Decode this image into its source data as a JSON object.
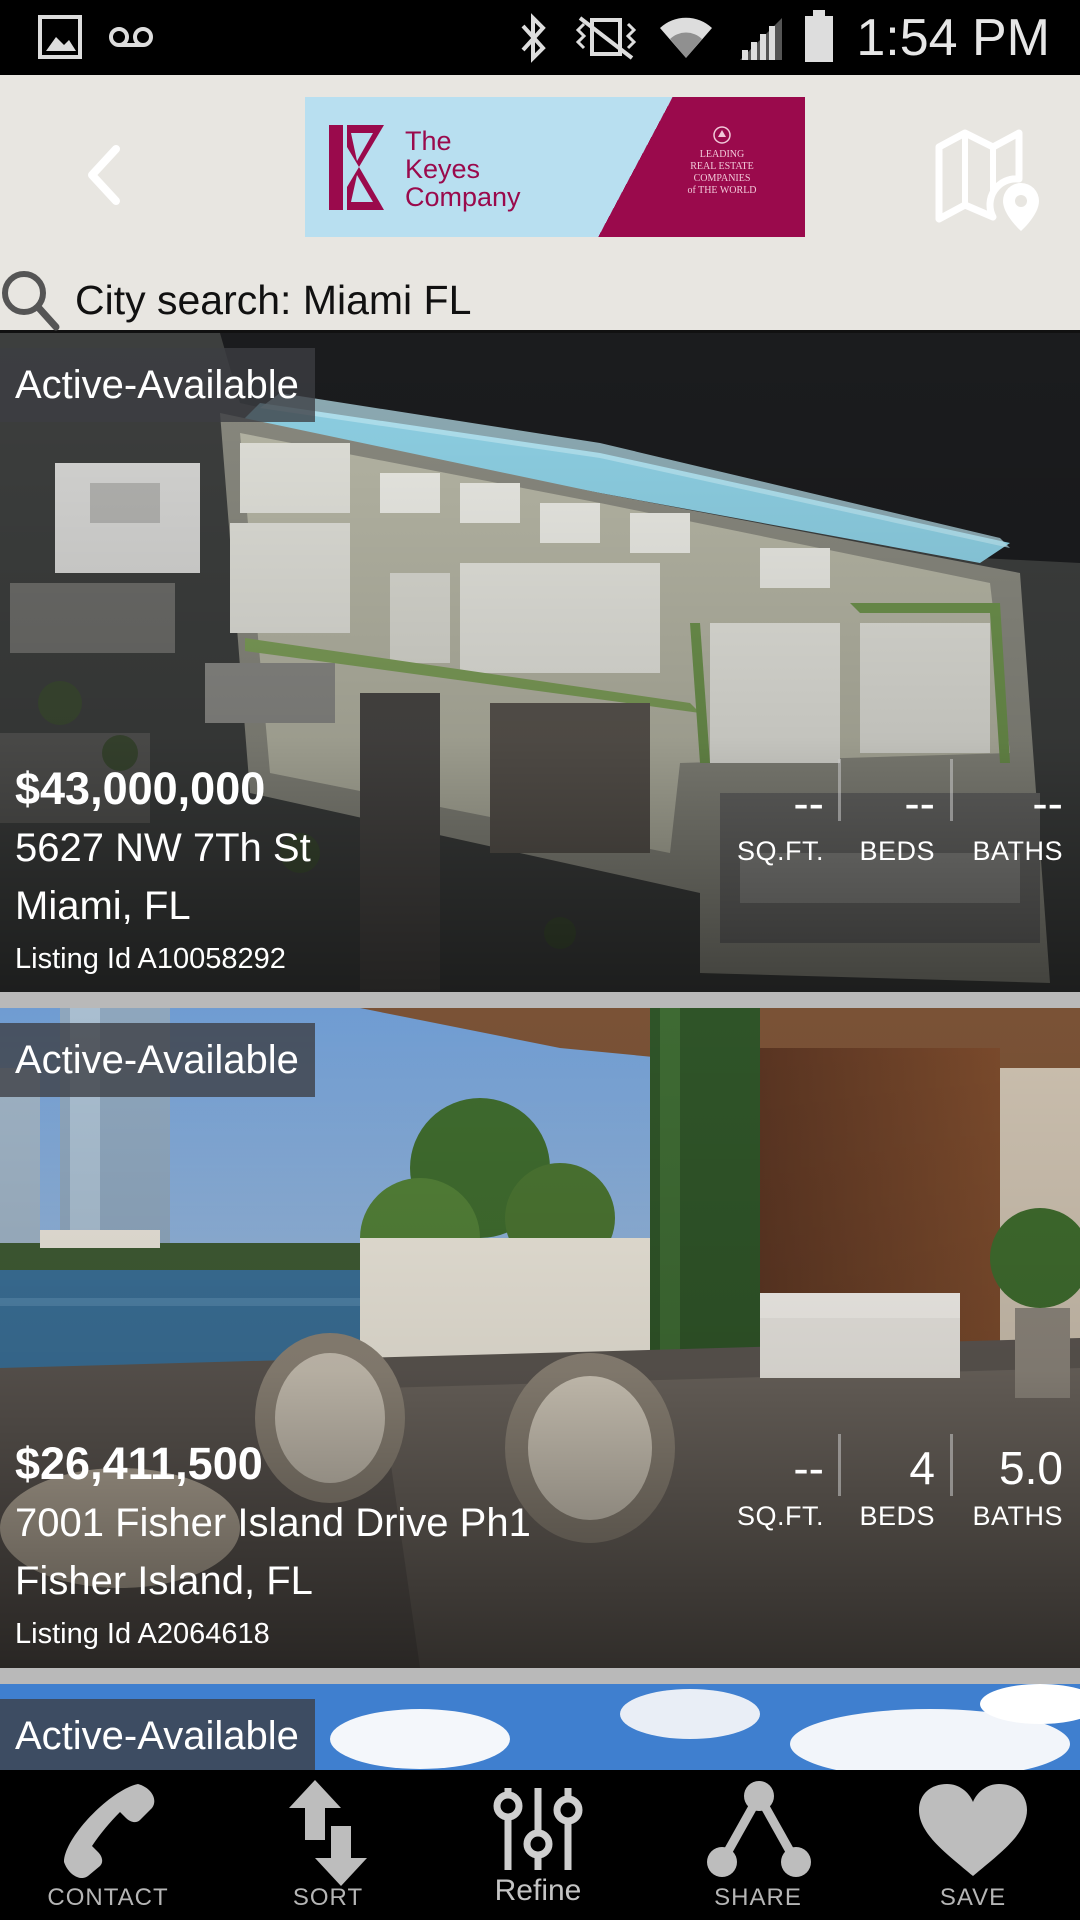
{
  "status_bar": {
    "time": "1:54 PM",
    "icons": [
      "image-icon",
      "voicemail-icon",
      "bluetooth-icon",
      "vibrate-icon",
      "wifi-icon",
      "signal-icon",
      "battery-icon"
    ]
  },
  "header": {
    "logo": {
      "line1": "The",
      "line2": "Keyes",
      "line3": "Company",
      "badge_line1": "LEADING",
      "badge_line2": "REAL ESTATE",
      "badge_line3": "COMPANIES",
      "badge_line4": "of THE WORLD"
    }
  },
  "search": {
    "text": "City search: Miami FL"
  },
  "listings": [
    {
      "status": "Active-Available",
      "price": "$43,000,000",
      "address_line1": "5627 NW 7Th St",
      "address_line2": "Miami, FL",
      "listing_id": "Listing Id A10058292",
      "sqft": "--",
      "beds": "--",
      "baths": "--",
      "sqft_label": "SQ.FT.",
      "beds_label": "BEDS",
      "baths_label": "BATHS"
    },
    {
      "status": "Active-Available",
      "price": "$26,411,500",
      "address_line1": "7001 Fisher Island Drive Ph1",
      "address_line2": "Fisher Island, FL",
      "listing_id": "Listing Id A2064618",
      "sqft": "--",
      "beds": "4",
      "baths": "5.0",
      "sqft_label": "SQ.FT.",
      "beds_label": "BEDS",
      "baths_label": "BATHS"
    },
    {
      "status": "Active-Available"
    }
  ],
  "bottom_nav": {
    "contact": "CONTACT",
    "sort": "SORT",
    "refine": "Refine",
    "share": "SHARE",
    "save": "SAVE"
  },
  "colors": {
    "brand_magenta": "#9a0a4c",
    "brand_sky": "#b8dff0",
    "header_bg": "#e8e6e1"
  }
}
